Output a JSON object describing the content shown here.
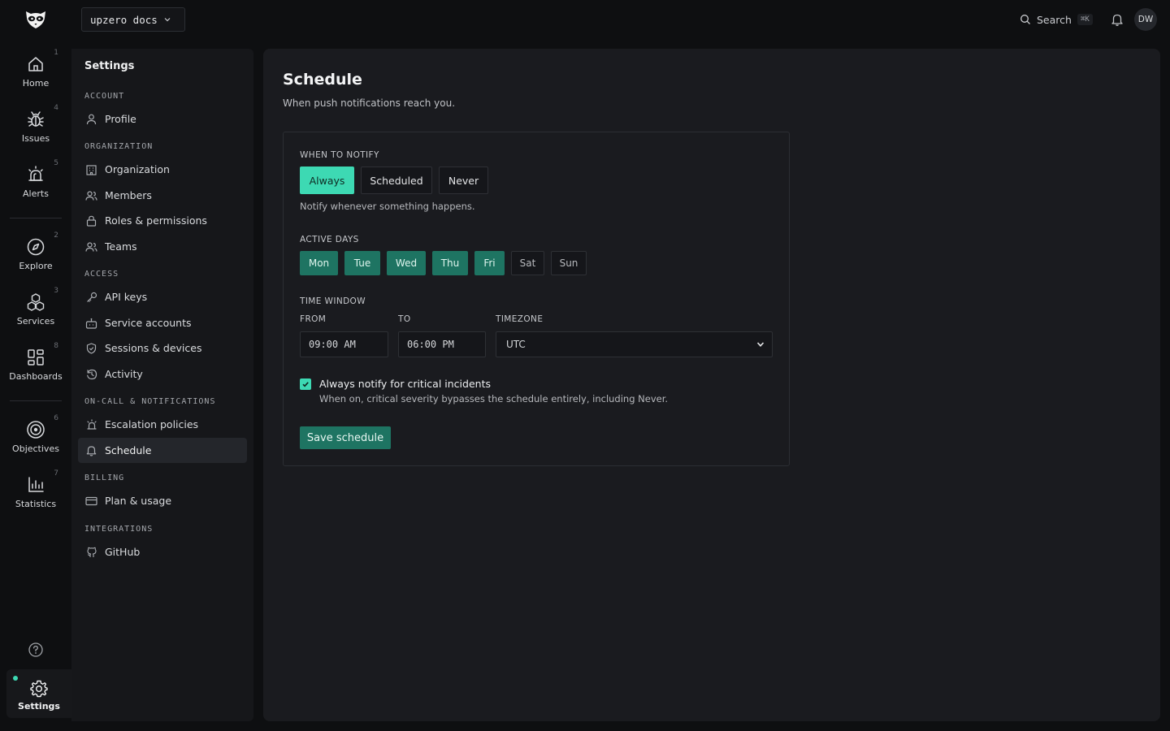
{
  "topbar": {
    "workspace": "upzero docs",
    "search_label": "Search",
    "search_shortcut": "⌘K",
    "avatar_initials": "DW"
  },
  "rail": {
    "items": [
      {
        "label": "Home",
        "shortcut": "1",
        "icon": "home-icon"
      },
      {
        "label": "Issues",
        "shortcut": "4",
        "icon": "bug-icon"
      },
      {
        "label": "Alerts",
        "shortcut": "5",
        "icon": "siren-icon"
      },
      {
        "label": "Explore",
        "shortcut": "2",
        "icon": "compass-icon"
      },
      {
        "label": "Services",
        "shortcut": "3",
        "icon": "cubes-icon"
      },
      {
        "label": "Dashboards",
        "shortcut": "8",
        "icon": "grid-icon"
      },
      {
        "label": "Objectives",
        "shortcut": "6",
        "icon": "target-icon"
      },
      {
        "label": "Statistics",
        "shortcut": "7",
        "icon": "bar-chart-icon"
      }
    ],
    "settings_label": "Settings"
  },
  "settings_nav": {
    "title": "Settings",
    "sections": [
      {
        "label": "ACCOUNT",
        "items": [
          {
            "label": "Profile",
            "icon": "user-icon"
          }
        ]
      },
      {
        "label": "ORGANIZATION",
        "items": [
          {
            "label": "Organization",
            "icon": "building-icon"
          },
          {
            "label": "Members",
            "icon": "users-icon"
          },
          {
            "label": "Roles & permissions",
            "icon": "lock-icon"
          },
          {
            "label": "Teams",
            "icon": "team-icon"
          }
        ]
      },
      {
        "label": "ACCESS",
        "items": [
          {
            "label": "API keys",
            "icon": "key-icon"
          },
          {
            "label": "Service accounts",
            "icon": "robot-icon"
          },
          {
            "label": "Sessions & devices",
            "icon": "shield-icon"
          },
          {
            "label": "Activity",
            "icon": "history-icon"
          }
        ]
      },
      {
        "label": "ON-CALL & NOTIFICATIONS",
        "items": [
          {
            "label": "Escalation policies",
            "icon": "siren-icon"
          },
          {
            "label": "Schedule",
            "icon": "bell-icon",
            "active": true
          }
        ]
      },
      {
        "label": "BILLING",
        "items": [
          {
            "label": "Plan & usage",
            "icon": "credit-card-icon"
          }
        ]
      },
      {
        "label": "INTEGRATIONS",
        "items": [
          {
            "label": "GitHub",
            "icon": "github-icon"
          }
        ]
      }
    ]
  },
  "main": {
    "title": "Schedule",
    "subtitle": "When push notifications reach you.",
    "when_to_notify": {
      "label": "WHEN TO NOTIFY",
      "options": [
        "Always",
        "Scheduled",
        "Never"
      ],
      "selected": "Always",
      "hint": "Notify whenever something happens."
    },
    "active_days": {
      "label": "ACTIVE DAYS",
      "days": [
        {
          "label": "Mon",
          "on": true
        },
        {
          "label": "Tue",
          "on": true
        },
        {
          "label": "Wed",
          "on": true
        },
        {
          "label": "Thu",
          "on": true
        },
        {
          "label": "Fri",
          "on": true
        },
        {
          "label": "Sat",
          "on": false
        },
        {
          "label": "Sun",
          "on": false
        }
      ]
    },
    "time_window": {
      "label": "TIME WINDOW",
      "from_label": "FROM",
      "from_value": "09:00 AM",
      "to_label": "TO",
      "to_value": "06:00 PM",
      "timezone_label": "TIMEZONE",
      "timezone_value": "UTC"
    },
    "critical": {
      "checked": true,
      "label": "Always notify for critical incidents",
      "hint": "When on, critical severity bypasses the schedule entirely, including Never."
    },
    "save_label": "Save schedule"
  },
  "colors": {
    "accent": "#3dd9b3",
    "accent_dark": "#1e7462",
    "background": "#0e0f11",
    "panel": "#1a1b1f"
  }
}
